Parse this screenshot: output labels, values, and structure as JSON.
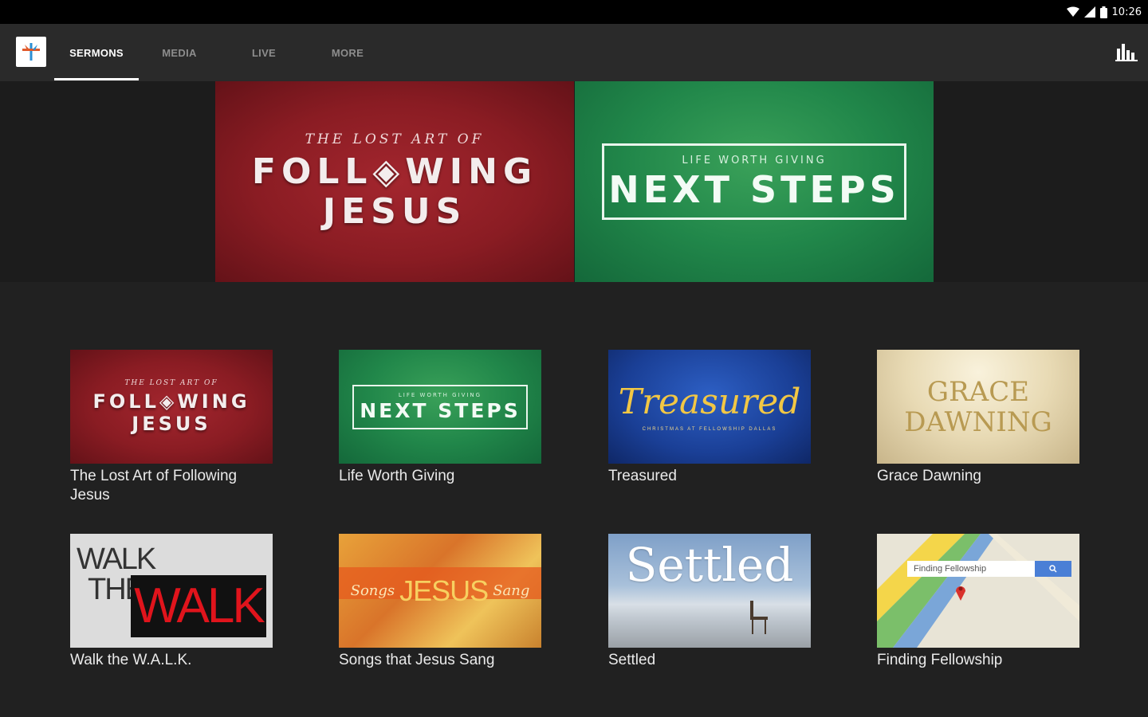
{
  "status_bar": {
    "time": "10:26"
  },
  "tabs": [
    {
      "label": "SERMONS",
      "active": true
    },
    {
      "label": "MEDIA",
      "active": false
    },
    {
      "label": "LIVE",
      "active": false
    },
    {
      "label": "MORE",
      "active": false
    }
  ],
  "hero": [
    {
      "overline": "THE LOST ART OF",
      "title_line1": "FOLL◈WING",
      "title_line2": "JESUS"
    },
    {
      "overline": "LIFE WORTH GIVING",
      "title": "NEXT STEPS"
    }
  ],
  "series": [
    {
      "title": "The Lost Art of Following Jesus",
      "art": {
        "overline": "THE LOST ART OF",
        "line1": "FOLL◈WING",
        "line2": "JESUS"
      }
    },
    {
      "title": "Life Worth Giving",
      "art": {
        "overline": "LIFE WORTH GIVING",
        "line1": "NEXT STEPS"
      }
    },
    {
      "title": "Treasured",
      "art": {
        "line1": "Treasured",
        "sub": "CHRISTMAS AT FELLOWSHIP DALLAS"
      }
    },
    {
      "title": "Grace Dawning",
      "art": {
        "line1": "GRACE",
        "line2": "DAWNING"
      }
    },
    {
      "title": "Walk the W.A.L.K.",
      "art": {
        "line1": "WALK",
        "line2": "THE",
        "line3": "WALK"
      }
    },
    {
      "title": "Songs that Jesus Sang",
      "art": {
        "line1": "Songs",
        "line2": "JESUS",
        "line3": "Sang"
      }
    },
    {
      "title": "Settled",
      "art": {
        "line1": "Settled"
      }
    },
    {
      "title": "Finding Fellowship",
      "art": {
        "search": "Finding Fellowship"
      }
    }
  ],
  "colors": {
    "tab_active": "#ffffff",
    "tab_inactive": "#8d8d8d",
    "app_bar": "#2a2a2a",
    "background": "#212121"
  }
}
